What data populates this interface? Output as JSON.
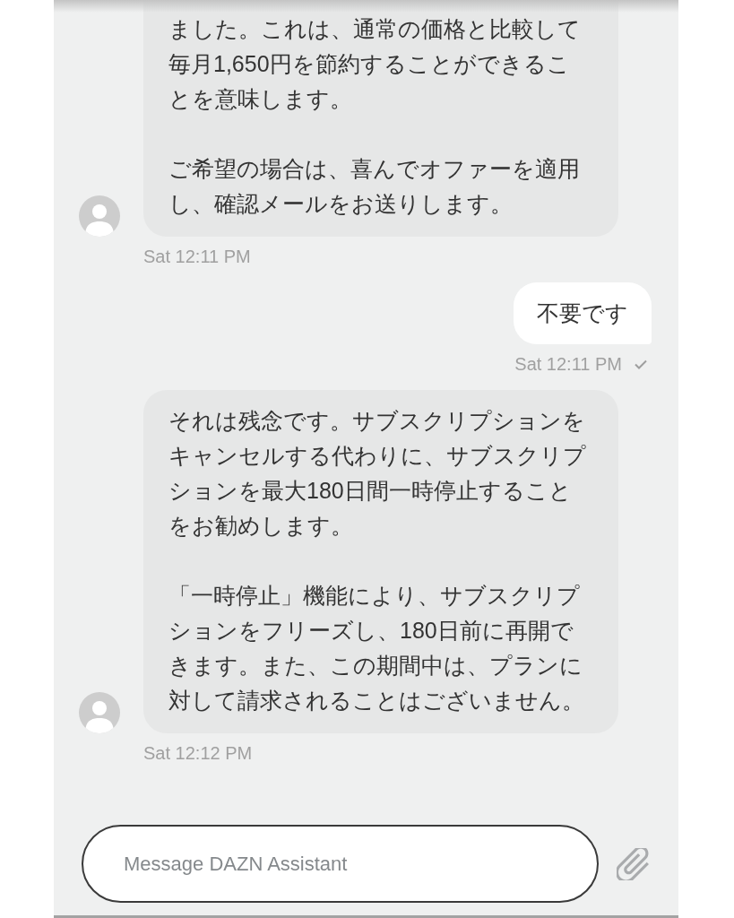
{
  "messages": [
    {
      "kind": "received",
      "paragraphs": [
        "ました。これは、通常の価格と比較して毎月1,650円を節約することができることを意味します。",
        "ご希望の場合は、喜んでオファーを適用し、確認メールをお送りします。"
      ],
      "time": "Sat 12:11 PM"
    },
    {
      "kind": "sent",
      "paragraphs": [
        "不要です"
      ],
      "time": "Sat 12:11 PM",
      "delivered": true
    },
    {
      "kind": "received",
      "paragraphs": [
        "それは残念です。サブスクリプションをキャンセルする代わりに、サブスクリプションを最大180日間一時停止することをお勧めします。",
        "「一時停止」機能により、サブスクリプションをフリーズし、180日前に再開できます。また、この期間中は、プランに対して請求されることはございません。"
      ],
      "time": "Sat 12:12 PM"
    }
  ],
  "composer": {
    "placeholder": "Message DAZN Assistant"
  }
}
